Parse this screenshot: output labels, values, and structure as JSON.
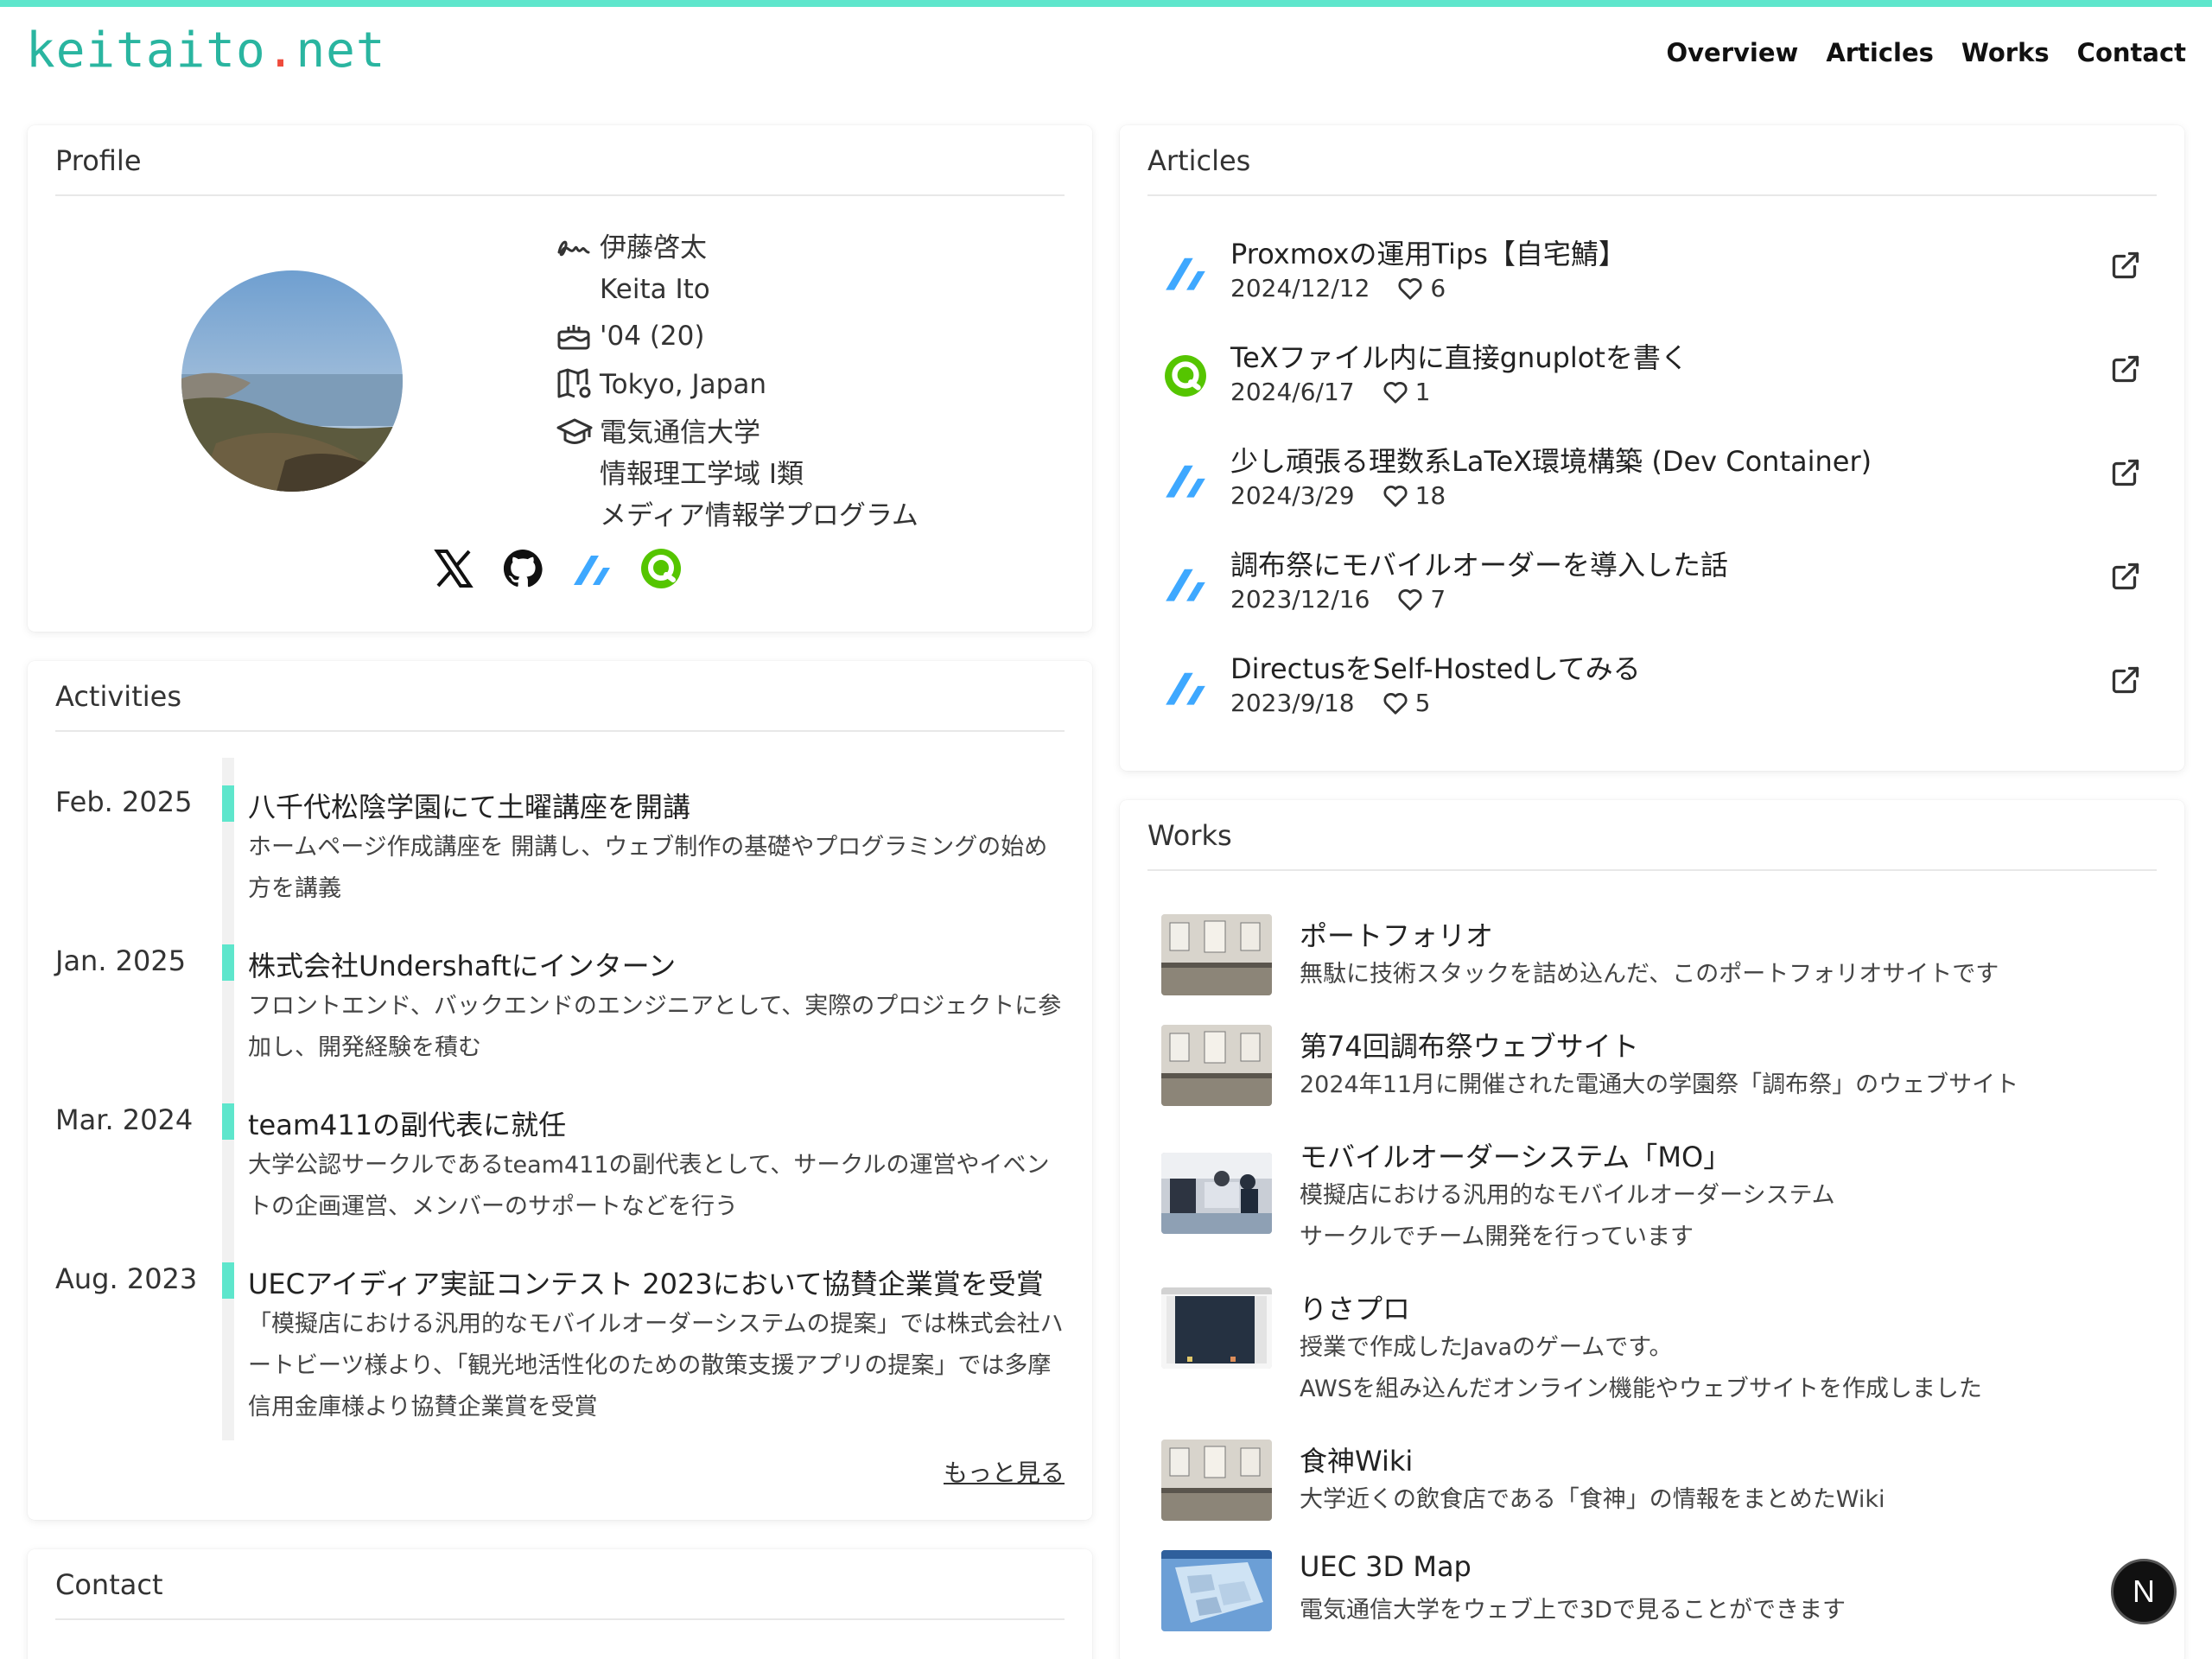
{
  "site": {
    "logo_main": "keitaito",
    "logo_dot": ".",
    "logo_tld": "net"
  },
  "nav": [
    "Overview",
    "Articles",
    "Works",
    "Contact"
  ],
  "profile": {
    "title": "Profile",
    "name_ja": "伊藤啓太",
    "name_en": "Keita Ito",
    "birth": "'04 (20)",
    "location": "Tokyo, Japan",
    "school": "電気通信大学",
    "faculty": "情報理工学域 I類",
    "program": "メディア情報学プログラム"
  },
  "activities": {
    "title": "Activities",
    "more": "もっと見る",
    "items": [
      {
        "date": "Feb. 2025",
        "title": "八千代松陰学園にて土曜講座を開講",
        "desc": "ホームページ作成講座を 開講し、ウェブ制作の基礎やプログラミングの始め方を講義"
      },
      {
        "date": "Jan. 2025",
        "title": "株式会社Undershaftにインターン",
        "desc": "フロントエンド、バックエンドのエンジニアとして、実際のプロジェクトに参加し、開発経験を積む"
      },
      {
        "date": "Mar. 2024",
        "title": "team411の副代表に就任",
        "desc": "大学公認サークルであるteam411の副代表として、サークルの運営やイベントの企画運営、メンバーのサポートなどを行う"
      },
      {
        "date": "Aug. 2023",
        "title": "UECアイディア実証コンテスト 2023において協賛企業賞を受賞",
        "desc": "「模擬店における汎用的なモバイルオーダーシステムの提案」では株式会社ハートビーツ様より、「観光地活性化のための散策支援アプリの提案」では多摩信用金庫様より協賛企業賞を受賞"
      }
    ]
  },
  "contact": {
    "title": "Contact"
  },
  "articles": {
    "title": "Articles",
    "items": [
      {
        "source": "zenn",
        "title": "Proxmoxの運用Tips【自宅鯖】",
        "date": "2024/12/12",
        "likes": "6"
      },
      {
        "source": "qiita",
        "title": "TeXファイル内に直接gnuplotを書く",
        "date": "2024/6/17",
        "likes": "1"
      },
      {
        "source": "zenn",
        "title": "少し頑張る理数系LaTeX環境構築 (Dev Container)",
        "date": "2024/3/29",
        "likes": "18"
      },
      {
        "source": "zenn",
        "title": "調布祭にモバイルオーダーを導入した話",
        "date": "2023/12/16",
        "likes": "7"
      },
      {
        "source": "zenn",
        "title": "DirectusをSelf-Hostedしてみる",
        "date": "2023/9/18",
        "likes": "5"
      }
    ]
  },
  "works": {
    "title": "Works",
    "items": [
      {
        "title": "ポートフォリオ",
        "desc": [
          "無駄に技術スタックを詰め込んだ、このポートフォリオサイトです"
        ]
      },
      {
        "title": "第74回調布祭ウェブサイト",
        "desc": [
          "2024年11月に開催された電通大の学園祭「調布祭」のウェブサイト"
        ]
      },
      {
        "title": "モバイルオーダーシステム「MO」",
        "desc": [
          "模擬店における汎用的なモバイルオーダーシステム",
          "サークルでチーム開発を行っています"
        ]
      },
      {
        "title": "りさプロ",
        "desc": [
          "授業で作成したJavaのゲームです。",
          "AWSを組み込んだオンライン機能やウェブサイトを作成しました"
        ]
      },
      {
        "title": "食神Wiki",
        "desc": [
          "大学近くの飲食店である「食神」の情報をまとめたWiki"
        ]
      },
      {
        "title": "UEC 3D Map",
        "desc": [
          "電気通信大学をウェブ上で3Dで見ることができます"
        ]
      }
    ]
  },
  "fab_label": "N",
  "colors": {
    "accent": "#5ee6cc",
    "logo": "#2ab5a0",
    "logo_dot": "#ef4b3c",
    "zenn": "#3ea8ff",
    "qiita": "#55c500"
  }
}
